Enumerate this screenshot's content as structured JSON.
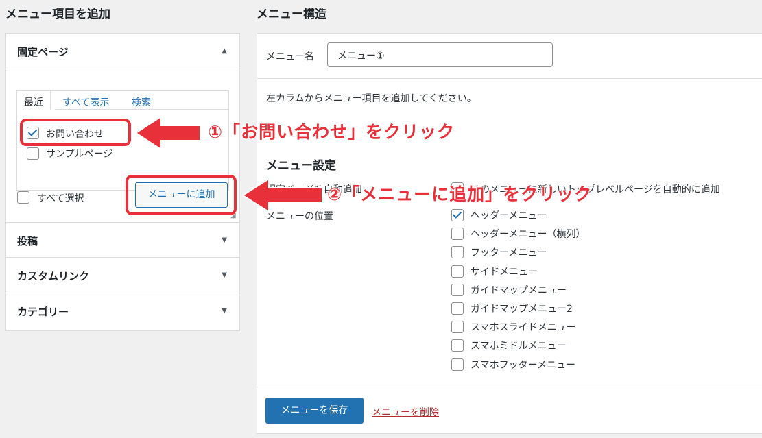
{
  "left": {
    "heading": "メニュー項目を追加",
    "sections": [
      {
        "label": "固定ページ",
        "arrow": "▲"
      },
      {
        "label": "投稿",
        "arrow": "▼"
      },
      {
        "label": "カスタムリンク",
        "arrow": "▼"
      },
      {
        "label": "カテゴリー",
        "arrow": "▼"
      }
    ],
    "tabs": [
      "最近",
      "すべて表示",
      "検索"
    ],
    "pages": [
      {
        "label": "お問い合わせ",
        "checked": true
      },
      {
        "label": "サンプルページ",
        "checked": false
      }
    ],
    "select_all": "すべて選択",
    "add_button": "メニューに追加"
  },
  "right": {
    "heading": "メニュー構造",
    "menu_name_label": "メニュー名",
    "menu_name_value": "メニュー①",
    "instruction": "左カラムからメニュー項目を追加してください。",
    "settings_heading": "メニュー設定",
    "auto_add_label": "固定ページを自動追加",
    "auto_add_text": "このメニューに新しいトップレベルページを自動的に追加",
    "location_label": "メニューの位置",
    "locations": [
      {
        "label": "ヘッダーメニュー",
        "checked": true
      },
      {
        "label": "ヘッダーメニュー（横列）",
        "checked": false
      },
      {
        "label": "フッターメニュー",
        "checked": false
      },
      {
        "label": "サイドメニュー",
        "checked": false
      },
      {
        "label": "ガイドマップメニュー",
        "checked": false
      },
      {
        "label": "ガイドマップメニュー2",
        "checked": false
      },
      {
        "label": "スマホスライドメニュー",
        "checked": false
      },
      {
        "label": "スマホミドルメニュー",
        "checked": false
      },
      {
        "label": "スマホフッターメニュー",
        "checked": false
      }
    ],
    "save_button": "メニューを保存",
    "delete_link": "メニューを削除"
  },
  "annotations": {
    "step1": "①「お問い合わせ」をクリック",
    "step2": "②「メニューに追加」をクリック",
    "color": "#e8303a"
  }
}
